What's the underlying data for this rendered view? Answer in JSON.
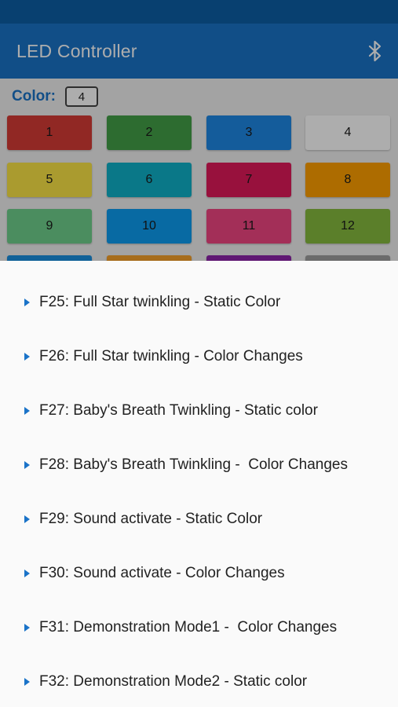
{
  "app": {
    "title": "LED Controller",
    "action_icon": "bluetooth-icon",
    "primary_color": "#1a73c8"
  },
  "color_selector": {
    "label": "Color:",
    "value": "4"
  },
  "color_buttons": [
    {
      "label": "1",
      "color": "#d63b35"
    },
    {
      "label": "2",
      "color": "#43a047"
    },
    {
      "label": "3",
      "color": "#1e88e5"
    },
    {
      "label": "4",
      "color": "#ffffff"
    },
    {
      "label": "5",
      "color": "#fbe546"
    },
    {
      "label": "6",
      "color": "#10b2c9"
    },
    {
      "label": "7",
      "color": "#e01a5a"
    },
    {
      "label": "8",
      "color": "#ffa000"
    },
    {
      "label": "9",
      "color": "#6fd08c"
    },
    {
      "label": "10",
      "color": "#0d9cf0"
    },
    {
      "label": "11",
      "color": "#f04682"
    },
    {
      "label": "12",
      "color": "#86bb3f"
    }
  ],
  "partial_row_colors": [
    "#1a8fe0",
    "#f6a12a",
    "#8e24aa",
    "#9e9e9e"
  ],
  "menu": {
    "items": [
      {
        "label": "F25: Full Star twinkling - Static Color"
      },
      {
        "label": "F26: Full Star twinkling - Color Changes"
      },
      {
        "label": "F27: Baby's Breath Twinkling - Static color"
      },
      {
        "label": "F28: Baby's Breath Twinkling -  Color Changes"
      },
      {
        "label": "F29: Sound activate - Static Color"
      },
      {
        "label": "F30: Sound activate - Color Changes"
      },
      {
        "label": "F31: Demonstration Mode1 -  Color Changes"
      },
      {
        "label": "F32: Demonstration Mode2 - Static color"
      }
    ]
  }
}
